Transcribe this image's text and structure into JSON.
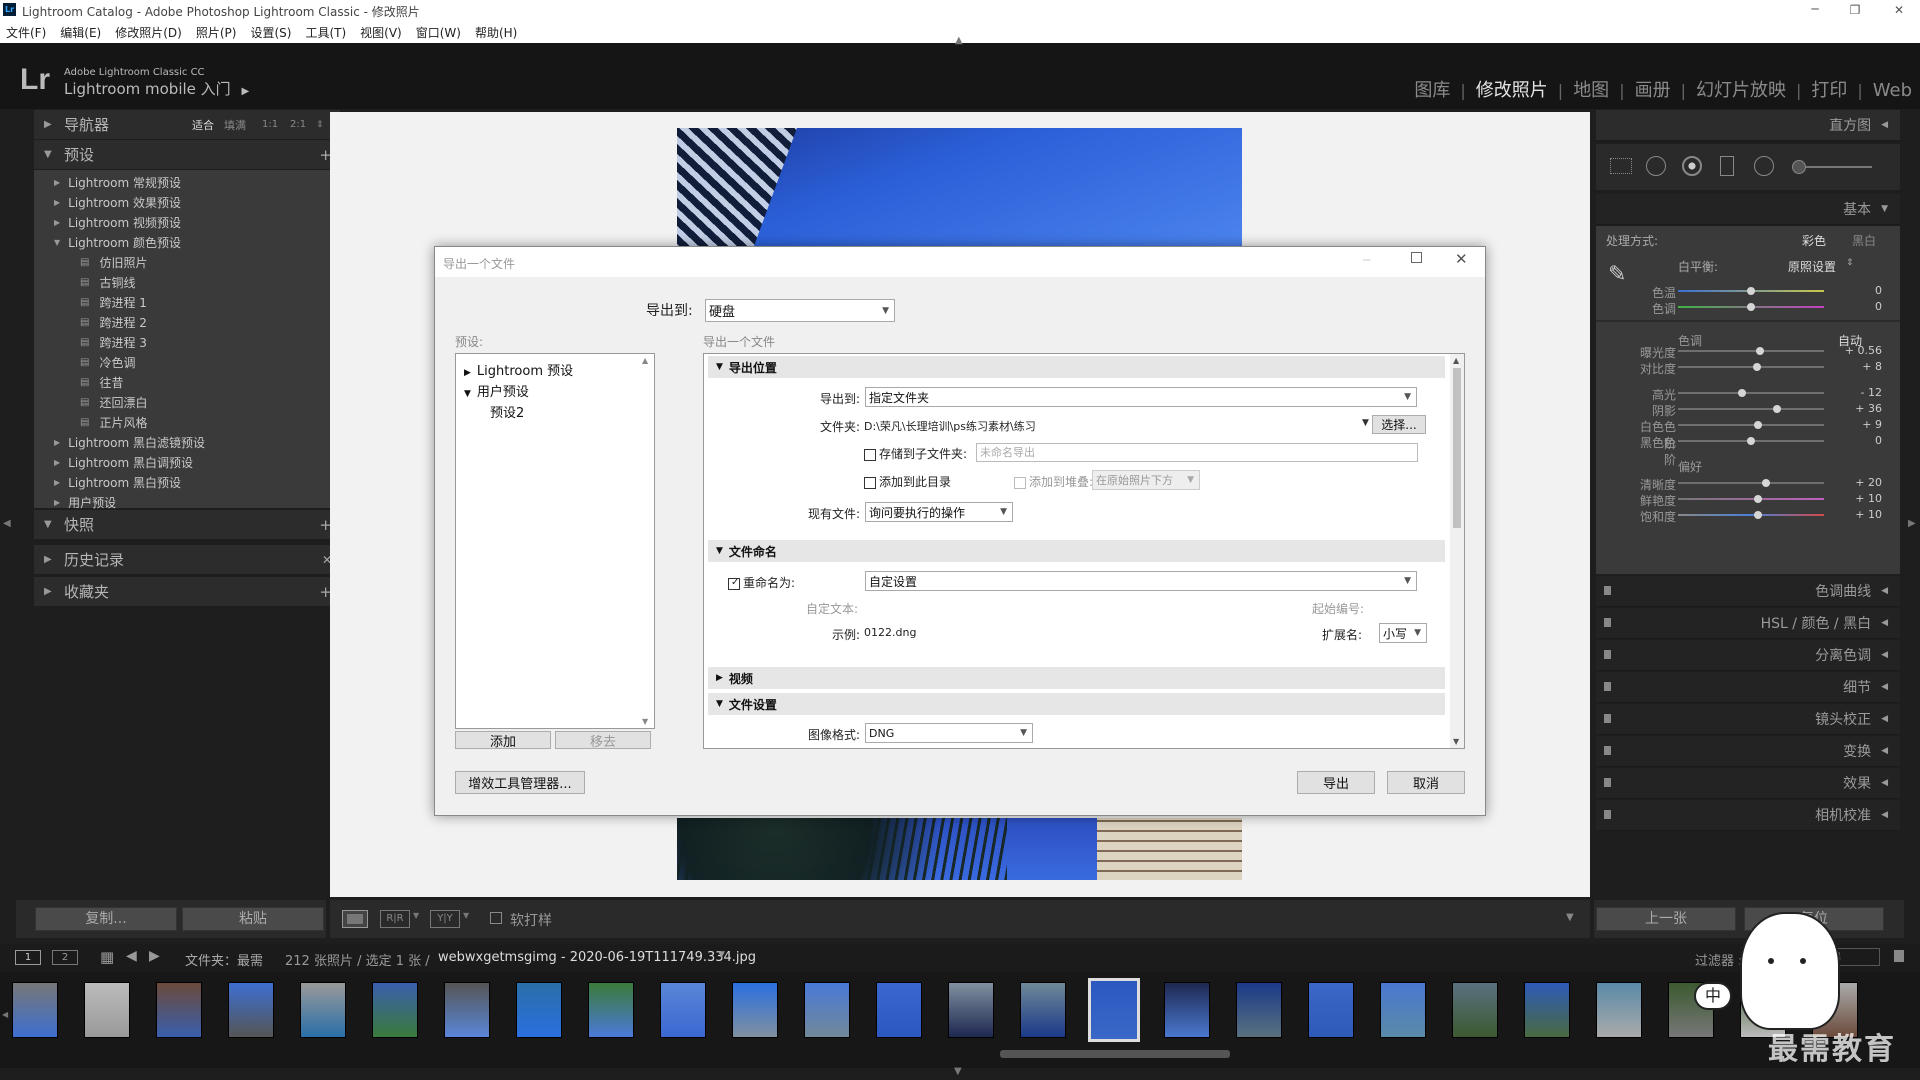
{
  "window": {
    "title": "Lightroom Catalog - Adobe Photoshop Lightroom Classic - 修改照片"
  },
  "menu": [
    "文件(F)",
    "编辑(E)",
    "修改照片(D)",
    "照片(P)",
    "设置(S)",
    "工具(T)",
    "视图(V)",
    "窗口(W)",
    "帮助(H)"
  ],
  "identity": {
    "logo": "Lr",
    "product": "Adobe Lightroom Classic CC",
    "mobile": "Lightroom mobile 入门"
  },
  "modules": [
    {
      "label": "图库"
    },
    {
      "label": "修改照片",
      "active": true
    },
    {
      "label": "地图"
    },
    {
      "label": "画册"
    },
    {
      "label": "幻灯片放映"
    },
    {
      "label": "打印"
    },
    {
      "label": "Web"
    }
  ],
  "left": {
    "navigator": {
      "title": "导航器",
      "zoom": [
        "适合",
        "填满",
        "1:1",
        "2:1"
      ]
    },
    "presets": {
      "title": "预设",
      "items": [
        {
          "label": "Lightroom 常规预设",
          "type": "folder"
        },
        {
          "label": "Lightroom 效果预设",
          "type": "folder"
        },
        {
          "label": "Lightroom 视频预设",
          "type": "folder"
        },
        {
          "label": "Lightroom 颜色预设",
          "type": "open"
        },
        {
          "label": "仿旧照片",
          "type": "preset"
        },
        {
          "label": "古铜线",
          "type": "preset"
        },
        {
          "label": "跨进程 1",
          "type": "preset"
        },
        {
          "label": "跨进程 2",
          "type": "preset"
        },
        {
          "label": "跨进程 3",
          "type": "preset"
        },
        {
          "label": "冷色调",
          "type": "preset"
        },
        {
          "label": "往昔",
          "type": "preset"
        },
        {
          "label": "还回漂白",
          "type": "preset"
        },
        {
          "label": "正片风格",
          "type": "preset"
        },
        {
          "label": "Lightroom 黑白滤镜预设",
          "type": "folder"
        },
        {
          "label": "Lightroom 黑白调预设",
          "type": "folder"
        },
        {
          "label": "Lightroom 黑白预设",
          "type": "folder"
        },
        {
          "label": "用户预设",
          "type": "folder"
        }
      ]
    },
    "snapshots": "快照",
    "history": "历史记录",
    "collections": "收藏夹",
    "copy": "复制...",
    "paste": "粘贴"
  },
  "right": {
    "histogram": "直方图",
    "basic": {
      "title": "基本",
      "treatment": "处理方式:",
      "color": "彩色",
      "bw": "黑白",
      "wb_label": "白平衡:",
      "wb_value": "原照设置",
      "temp": {
        "label": "色温",
        "value": "0"
      },
      "tint": {
        "label": "色调",
        "value": "0"
      },
      "tone": "色调",
      "auto": "自动",
      "sliders": [
        {
          "label": "曝光度",
          "value": "+ 0.56",
          "pos": 0.56
        },
        {
          "label": "对比度",
          "value": "+ 8",
          "pos": 0.54
        },
        {
          "label": "高光",
          "value": "- 12",
          "pos": 0.44
        },
        {
          "label": "阴影",
          "value": "+ 36",
          "pos": 0.68
        },
        {
          "label": "白色色阶",
          "value": "+ 9",
          "pos": 0.545
        },
        {
          "label": "黑色色阶",
          "value": "0",
          "pos": 0.5
        },
        {
          "label": "清晰度",
          "value": "+ 20",
          "pos": 0.6
        },
        {
          "label": "鲜艳度",
          "value": "+ 10",
          "pos": 0.55
        },
        {
          "label": "饱和度",
          "value": "+ 10",
          "pos": 0.55
        }
      ],
      "presence": "偏好"
    },
    "panels": [
      "色调曲线",
      "HSL / 颜色 / 黑白",
      "分离色调",
      "细节",
      "镜头校正",
      "变换",
      "效果",
      "相机校准"
    ],
    "prev": "上一张",
    "reset": "复位"
  },
  "toolbar": {
    "softproof": "软打样"
  },
  "filmstrip": {
    "path": "文件夹：最需",
    "count": "212 张照片 / 选定 1 张 /",
    "file": "webwxgetmsgimg - 2020-06-19T111749.334.jpg",
    "filter": "过滤器 :",
    "filter_off": "过滤器"
  },
  "dialog": {
    "title": "导出一个文件",
    "export_to_label": "导出到:",
    "export_to": "硬盘",
    "presets_label": "预设:",
    "presets_tree": [
      "Lightroom 预设",
      "用户预设",
      "预设2"
    ],
    "add": "添加",
    "remove": "移去",
    "content_label": "导出一个文件",
    "location": {
      "title": "导出位置",
      "export_to_label": "导出到:",
      "export_to": "指定文件夹",
      "folder_label": "文件夹:",
      "folder": "D:\\荣凡\\长理培训\\ps练习素材\\练习",
      "choose": "选择...",
      "subfolder": "存储到子文件夹:",
      "subfolder_placeholder": "未命名导出",
      "add_catalog": "添加到此目录",
      "add_stack": "添加到堆叠:",
      "stack_pos": "在原始照片下方",
      "existing_label": "现有文件:",
      "existing": "询问要执行的操作"
    },
    "naming": {
      "title": "文件命名",
      "rename": "重命名为:",
      "rename_value": "自定设置",
      "custom_text": "自定文本:",
      "start_num": "起始编号:",
      "example_label": "示例:",
      "example": "0122.dng",
      "ext_label": "扩展名:",
      "ext": "小写"
    },
    "video": "视频",
    "file_settings": {
      "title": "文件设置",
      "format_label": "图像格式:",
      "format": "DNG"
    },
    "plugin": "增效工具管理器...",
    "export": "导出",
    "cancel": "取消"
  },
  "watermark": {
    "ime": "中",
    "brand": "最需教育"
  }
}
